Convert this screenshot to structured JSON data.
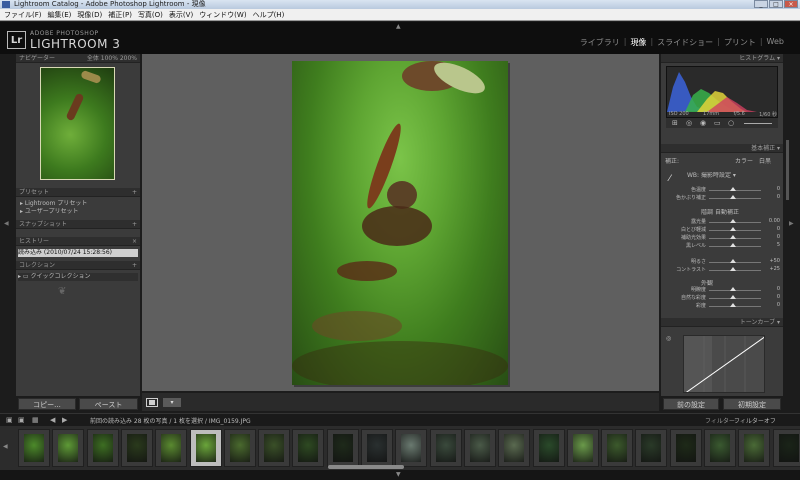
{
  "window": {
    "title": "Lightroom Catalog - Adobe Photoshop Lightroom - 現像",
    "buttons": [
      "_",
      "□",
      "×"
    ]
  },
  "menubar": [
    "ファイル(F)",
    "編集(E)",
    "現像(D)",
    "補正(P)",
    "写真(O)",
    "表示(V)",
    "ウィンドウ(W)",
    "ヘルプ(H)"
  ],
  "identity": {
    "logo": "Lr",
    "small": "ADOBE PHOTOSHOP",
    "big": "LIGHTROOM 3"
  },
  "modules": [
    {
      "label": "ライブラリ",
      "active": false
    },
    {
      "label": "現像",
      "active": true
    },
    {
      "label": "スライドショー",
      "active": false
    },
    {
      "label": "プリント",
      "active": false
    },
    {
      "label": "Web",
      "active": false
    }
  ],
  "left_panel": {
    "navigator": {
      "title": "ナビゲーター",
      "zoom": "全体 100% 200%"
    },
    "presets": {
      "title": "プリセット",
      "items": [
        "Lightroom プリセット",
        "ユーザープリセット"
      ]
    },
    "snapshots": {
      "title": "スナップショット"
    },
    "history": {
      "title": "ヒストリー",
      "items": [
        "読み込み (2010/07/24 15:28:56)"
      ]
    },
    "collections": {
      "title": "コレクション",
      "items": [
        "クイックコレクション"
      ]
    },
    "copy_button": "コピー...",
    "paste_button": "ペースト"
  },
  "right_panel": {
    "histogram_title": "ヒストグラム",
    "histo_labels": [
      "ISO 200",
      "17mm",
      "f/5.6",
      "1/60 秒"
    ],
    "basic": {
      "title": "基本補正",
      "treatment_label": "補正:",
      "treatment_options": [
        "カラー",
        "白黒"
      ],
      "wb_label": "WB:",
      "wb_value": "撮影時設定",
      "tone_label": "階調",
      "tone_auto": "自動補正",
      "presence_label": "外観",
      "sliders": [
        {
          "label": "色温度",
          "value": "0"
        },
        {
          "label": "色かぶり補正",
          "value": "0"
        },
        {
          "label": "露光量",
          "value": "0.00"
        },
        {
          "label": "白とび軽減",
          "value": "0"
        },
        {
          "label": "補助光効果",
          "value": "0"
        },
        {
          "label": "黒レベル",
          "value": "5"
        },
        {
          "label": "明るさ",
          "value": "+50"
        },
        {
          "label": "コントラスト",
          "value": "+25"
        },
        {
          "label": "明瞭度",
          "value": "0"
        },
        {
          "label": "自然な彩度",
          "value": "0"
        },
        {
          "label": "彩度",
          "value": "0"
        }
      ]
    },
    "tone_curve_title": "トーンカーブ",
    "prev_button": "前の設定",
    "reset_button": "初期設定"
  },
  "filmstrip": {
    "bar_text": "前回の読み込み   28 枚の写真 / 1 枚を選択 / IMG_0159.JPG",
    "filter_label": "フィルター:",
    "filter_value": "フィルターオフ",
    "selected_index": 5
  },
  "colors": {
    "panel_bg": "#3b3b3b",
    "center_bg": "#5f5f5f",
    "accent_active": "#ffffff"
  }
}
